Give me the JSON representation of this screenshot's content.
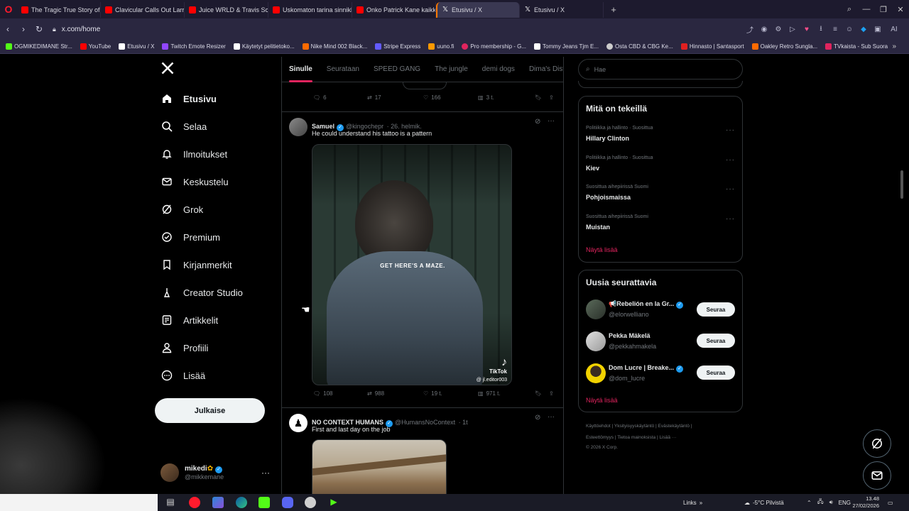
{
  "browser": {
    "tabs": [
      {
        "label": "The Tragic True Story of Ju",
        "color": "#ff0000"
      },
      {
        "label": "Clavicular Calls Out Larry",
        "color": "#ff0000"
      },
      {
        "label": "Juice WRLD & Travis Scott",
        "color": "#ff0000"
      },
      {
        "label": "Uskomaton tarina sinnikk",
        "color": "#ff0000"
      },
      {
        "label": "Onko Patrick Kane kaikki",
        "color": "#ff0000"
      },
      {
        "label": "Etusivu / X",
        "color": "#ffffff"
      },
      {
        "label": "Etusivu / X",
        "color": "#ffffff"
      }
    ],
    "url": "x.com/home",
    "bookmarks": [
      {
        "label": "OGMIKEDIMANE Str...",
        "color": "#53fc18"
      },
      {
        "label": "YouTube",
        "color": "#ff0000"
      },
      {
        "label": "Etusivu / X",
        "color": "#ffffff"
      },
      {
        "label": "Twitch Emote Resizer",
        "color": "#9146ff"
      },
      {
        "label": "Käytetyt pelitietoko...",
        "color": "#ffffff"
      },
      {
        "label": "Nike Mind 002 Black...",
        "color": "#ff6b00"
      },
      {
        "label": "Stripe Express",
        "color": "#635bff"
      },
      {
        "label": "uuno.fi",
        "color": "#ff9900"
      },
      {
        "label": "Pro membership - G...",
        "color": "#e0245e"
      },
      {
        "label": "Tommy Jeans Tjm E...",
        "color": "#ffffff"
      },
      {
        "label": "Osta CBD & CBG Ke...",
        "color": "#cccccc"
      },
      {
        "label": "Hinnasto | Santasport",
        "color": "#e02020"
      },
      {
        "label": "Oakley Retro Sungla...",
        "color": "#ff6b00"
      },
      {
        "label": "TVkaista - Sub Suora",
        "color": "#e0245e"
      }
    ]
  },
  "nav": {
    "items": [
      {
        "label": "Etusivu"
      },
      {
        "label": "Selaa"
      },
      {
        "label": "Ilmoitukset"
      },
      {
        "label": "Keskustelu"
      },
      {
        "label": "Grok"
      },
      {
        "label": "Premium"
      },
      {
        "label": "Kirjanmerkit"
      },
      {
        "label": "Creator Studio"
      },
      {
        "label": "Artikkelit"
      },
      {
        "label": "Profiili"
      },
      {
        "label": "Lisää"
      }
    ],
    "post_label": "Julkaise",
    "profile": {
      "name": "mikedi",
      "handle": "@mikkemane",
      "more": "···"
    }
  },
  "feed": {
    "tabs": [
      "Sinulle",
      "Seurataan",
      "SPEED GANG",
      "The jungle",
      "demi dogs",
      "Dima's Dist"
    ],
    "top_actions": {
      "replies": "6",
      "reposts": "17",
      "likes": "166",
      "views": "3 t."
    },
    "tweet1": {
      "name": "Samuel",
      "handle": "@kingochepr",
      "date": "· 26. helmik.",
      "text": "He could understand his tattoo is a pattern",
      "caption": "GET HERE'S A MAZE.",
      "watermark_app": "TikTok",
      "watermark_user": "@ jl.editor003",
      "actions": {
        "replies": "108",
        "reposts": "988",
        "likes": "19 t.",
        "views": "971 t."
      }
    },
    "tweet2": {
      "name": "NO CONTEXT HUMANS",
      "handle": "@HumansNoContext",
      "date": "· 1t",
      "text": "First and last day on the job"
    }
  },
  "sidebar": {
    "search_placeholder": "Hae",
    "trends_title": "Mitä on tekeillä",
    "trends": [
      {
        "meta": "Politiikka ja hallinto · Suosittua",
        "name": "Hillary Clinton"
      },
      {
        "meta": "Politiikka ja hallinto · Suosittua",
        "name": "Kiev"
      },
      {
        "meta": "Suosittua aihepiirissä Suomi",
        "name": "Pohjoismaissa"
      },
      {
        "meta": "Suosittua aihepiirissä Suomi",
        "name": "Muistan"
      }
    ],
    "show_more": "Näytä lisää",
    "follow_title": "Uusia seurattavia",
    "who_to_follow": [
      {
        "name": "📢Rebelión en la Gr...",
        "handle": "@elorwelliano",
        "button": "Seuraa"
      },
      {
        "name": "Pekka Mäkelä",
        "handle": "@pekkahmakela",
        "button": "Seuraa"
      },
      {
        "name": "Dom Lucre | Breake...",
        "handle": "@dom_lucre",
        "button": "Seuraa"
      }
    ],
    "footer": {
      "line1": "Käyttöehdot  |  Yksityisyyskäytäntö  |  Evästekäytäntö  |",
      "line2": "Esteettömyys  |  Tietoa mainoksista  |  Lisää ···",
      "line3": "© 2026 X Corp."
    }
  },
  "taskbar": {
    "links": "Links",
    "weather": "-5°C  Pilvistä",
    "lang": "ENG",
    "time": "13.48",
    "date": "27/02/2026"
  }
}
